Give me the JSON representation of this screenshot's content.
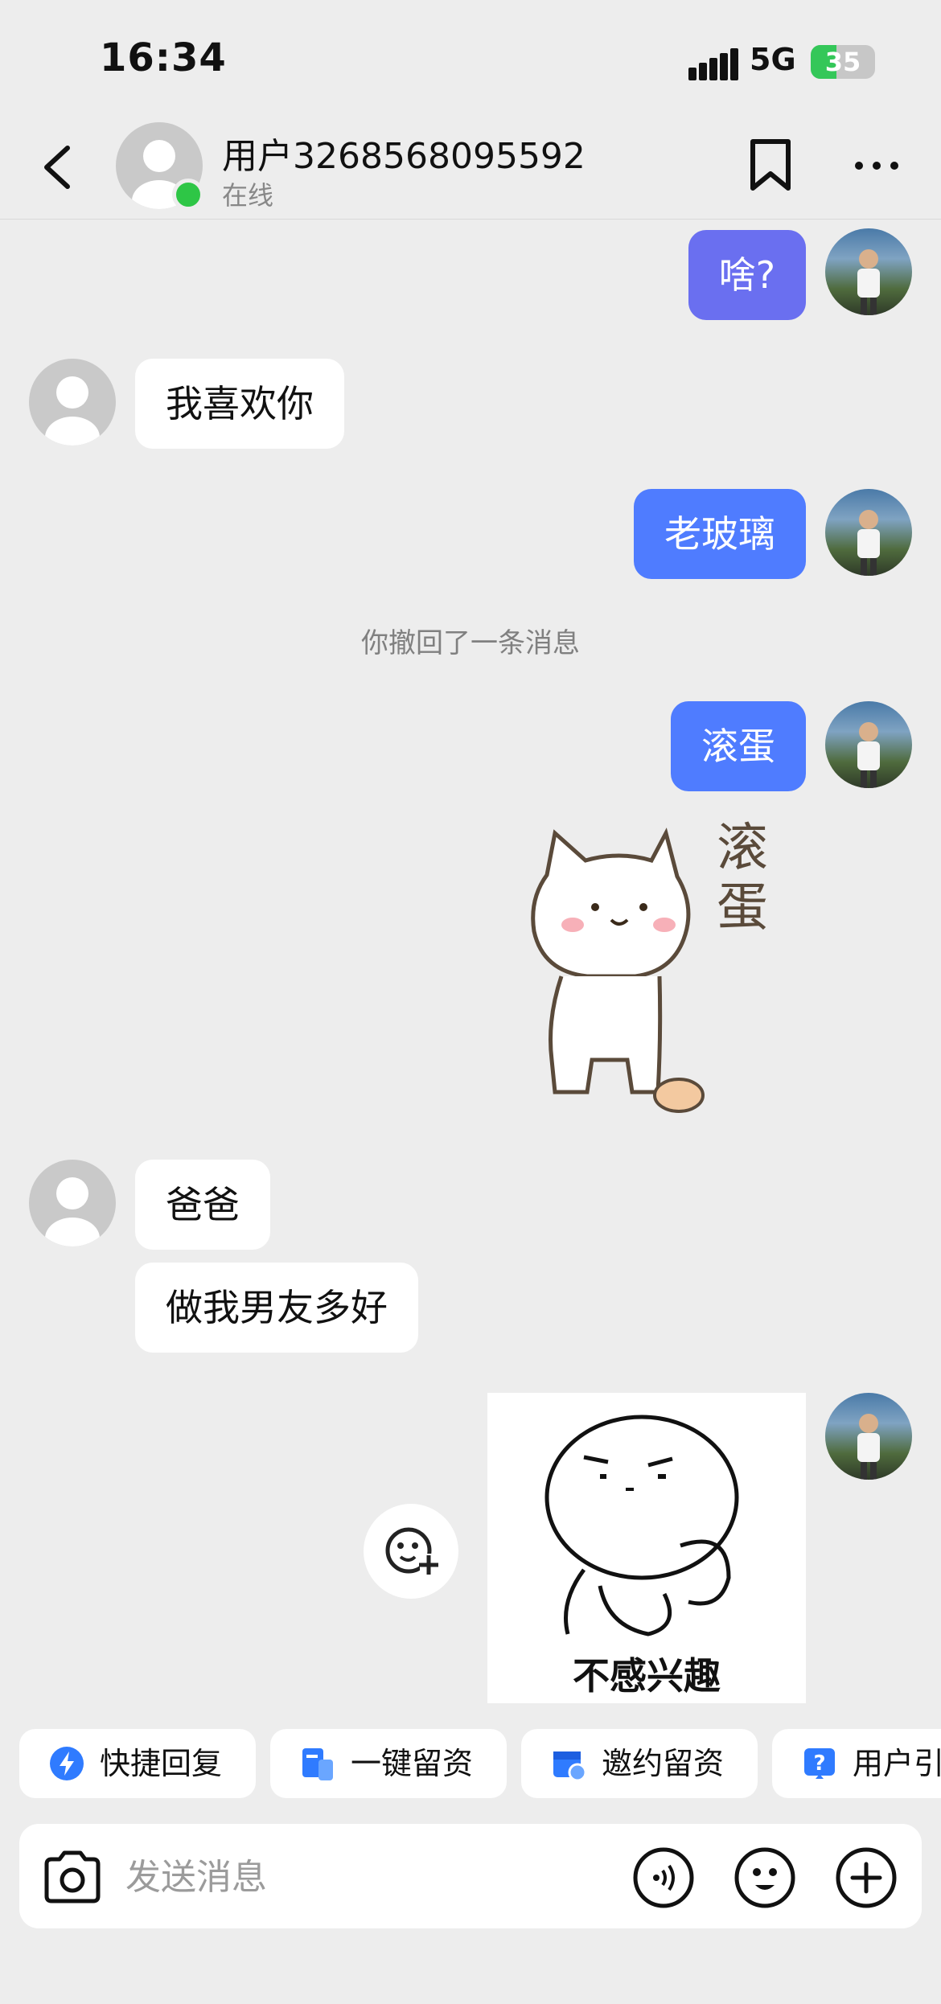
{
  "status_bar": {
    "time": "16:34",
    "network": "5G",
    "battery": "35"
  },
  "header": {
    "name": "用户3268568095592",
    "status": "在线"
  },
  "messages": [
    {
      "side": "right",
      "text": "啥?"
    },
    {
      "side": "left",
      "text": "我喜欢你"
    },
    {
      "side": "right",
      "text": "老玻璃"
    },
    {
      "side": "system",
      "text": "你撤回了一条消息"
    },
    {
      "side": "right",
      "text": "滚蛋"
    },
    {
      "side": "right",
      "type": "sticker",
      "text": "滚蛋"
    },
    {
      "side": "left",
      "text": "爸爸"
    },
    {
      "side": "left",
      "text": "做我男友多好"
    },
    {
      "side": "right",
      "type": "sticker",
      "text": "不感兴趣"
    }
  ],
  "quick_actions": [
    {
      "label": "快捷回复",
      "icon": "lightning-icon"
    },
    {
      "label": "一键留资",
      "icon": "form-icon"
    },
    {
      "label": "邀约留资",
      "icon": "calendar-icon"
    },
    {
      "label": "用户引",
      "icon": "question-icon"
    }
  ],
  "input": {
    "placeholder": "发送消息"
  },
  "colors": {
    "bubble_sent": "#4f7cff",
    "bubble_received": "#ffffff",
    "background": "#ededed",
    "online": "#2ec646"
  }
}
